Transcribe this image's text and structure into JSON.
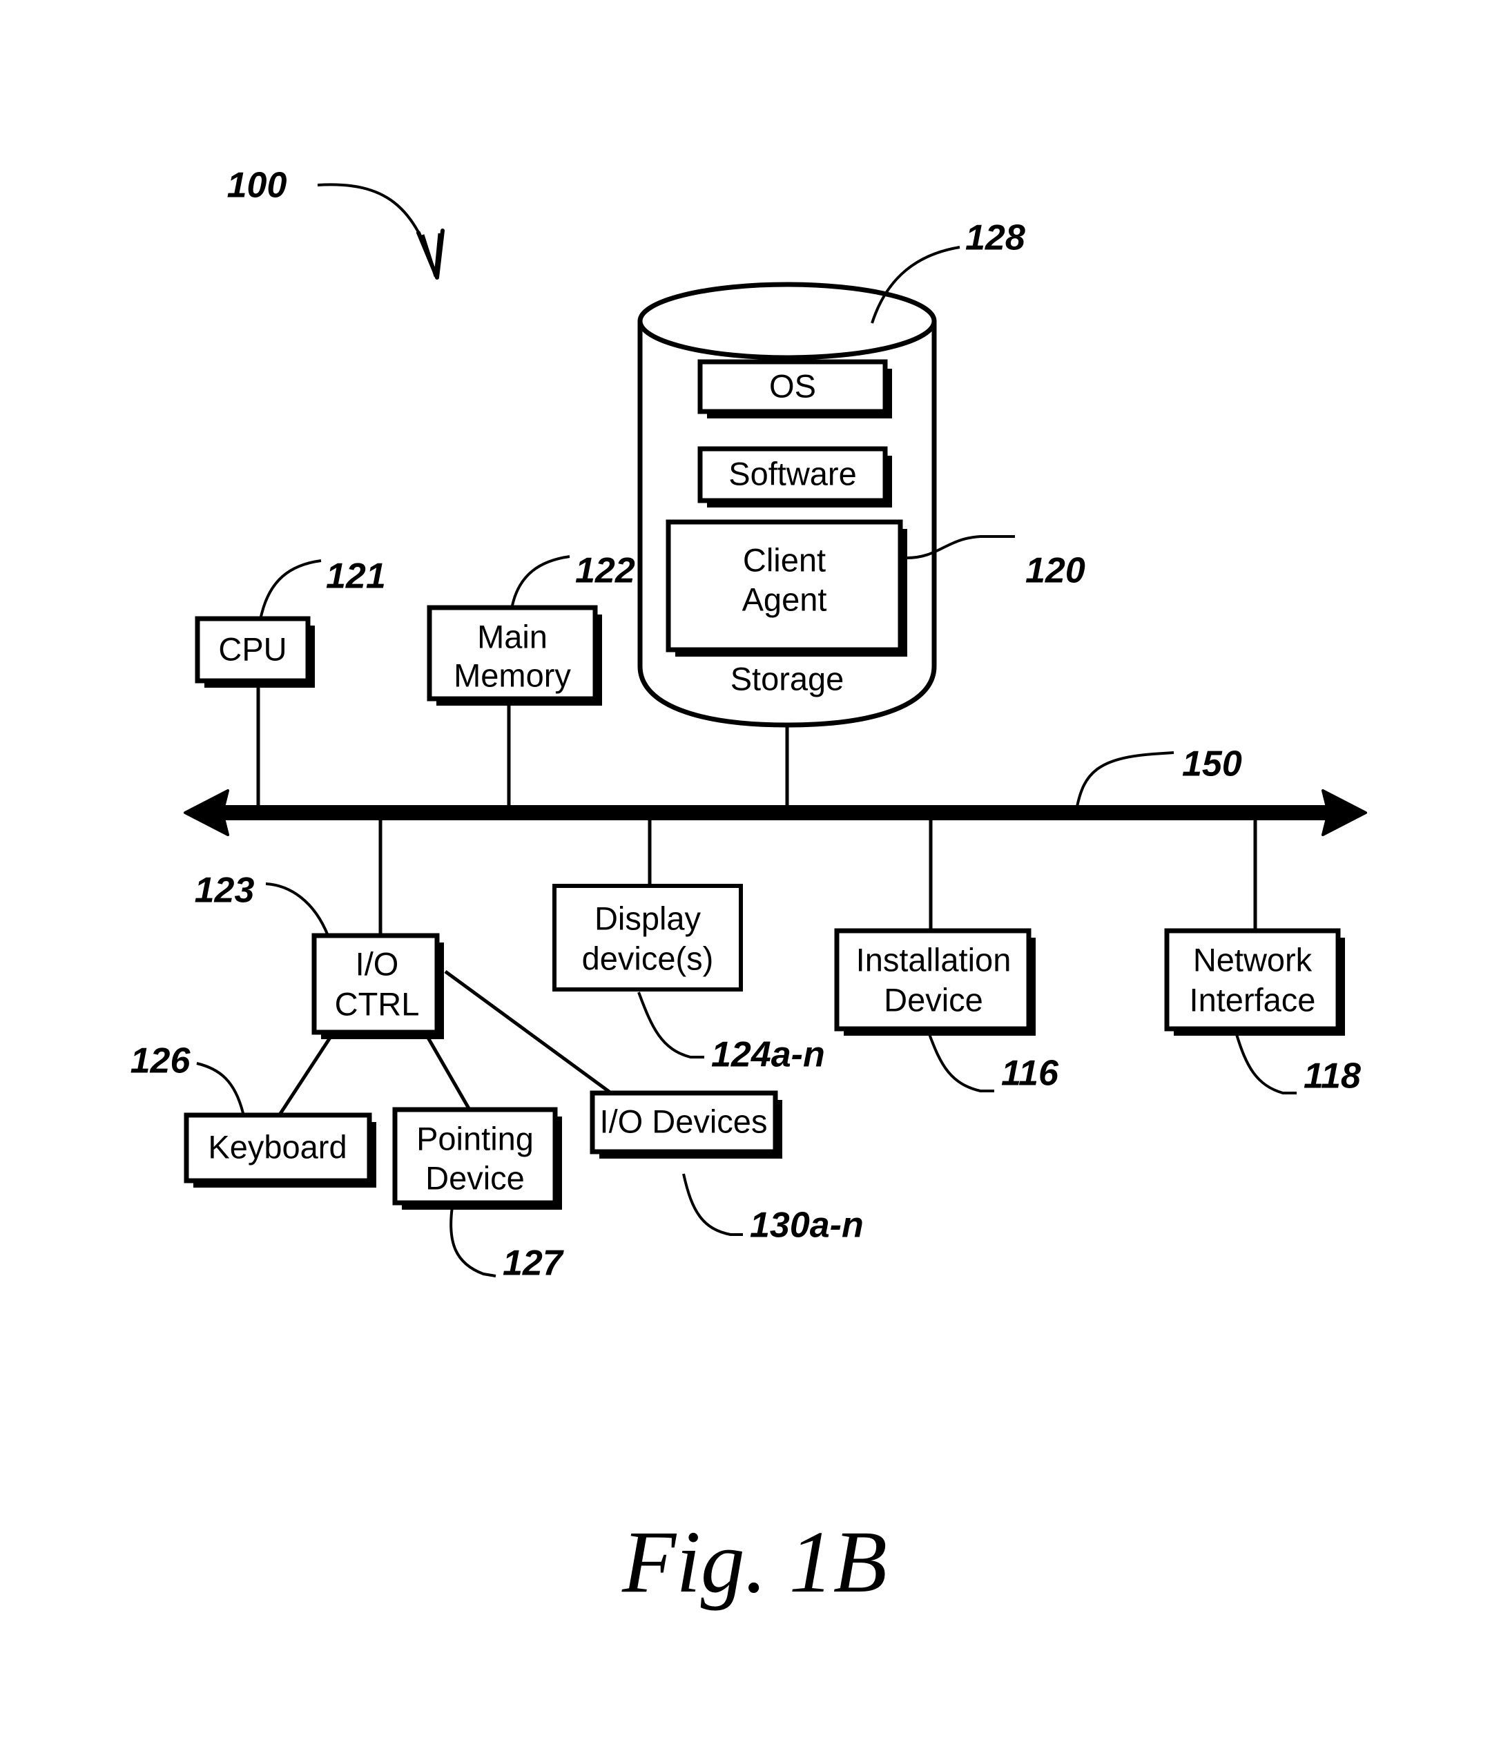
{
  "figure": {
    "caption": "Fig. 1B",
    "system_ref": "100"
  },
  "storage": {
    "label": "Storage",
    "ref": "128",
    "items": [
      {
        "label": "OS"
      },
      {
        "label": "Software"
      },
      {
        "label": "Client\nAgent",
        "line1": "Client",
        "line2": "Agent",
        "ref": "120"
      }
    ]
  },
  "bus": {
    "ref": "150"
  },
  "components": {
    "cpu": {
      "line1": "CPU",
      "line2": "",
      "ref": "121"
    },
    "main_memory": {
      "line1": "Main",
      "line2": "Memory",
      "ref": "122"
    },
    "io_ctrl": {
      "line1": "I/O",
      "line2": "CTRL",
      "ref": "123"
    },
    "display": {
      "line1": "Display",
      "line2": "device(s)",
      "ref": "124a-n"
    },
    "installation": {
      "line1": "Installation",
      "line2": "Device",
      "ref": "116"
    },
    "network": {
      "line1": "Network",
      "line2": "Interface",
      "ref": "118"
    },
    "keyboard": {
      "line1": "Keyboard",
      "line2": "",
      "ref": "126"
    },
    "pointing": {
      "line1": "Pointing",
      "line2": "Device",
      "ref": "127"
    },
    "io_devices": {
      "line1": "I/O Devices",
      "line2": "",
      "ref": "130a-n"
    }
  },
  "colors": {
    "ink": "#000000",
    "paper": "#ffffff"
  }
}
